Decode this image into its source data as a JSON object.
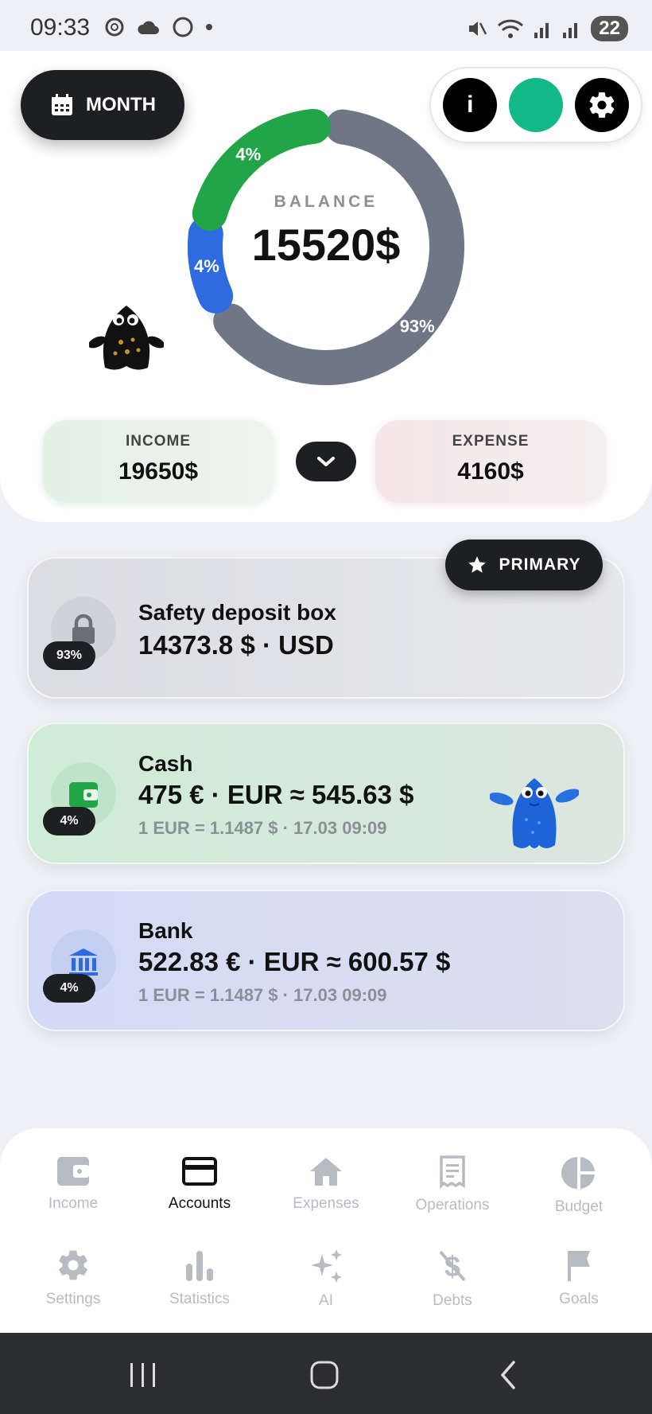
{
  "status_bar": {
    "time": "09:33",
    "battery": "22"
  },
  "header": {
    "period_button": "MONTH",
    "info_button": "i",
    "theme_color": "#12b886",
    "settings_icon": "gear-icon"
  },
  "balance": {
    "label": "BALANCE",
    "value": "15520$",
    "segments": [
      {
        "percent_label": "93%",
        "color": "#6f7685",
        "fraction": 0.93
      },
      {
        "percent_label": "4%",
        "color": "#2f6be0",
        "fraction": 0.04
      },
      {
        "percent_label": "4%",
        "color": "#22a546",
        "fraction": 0.04
      }
    ]
  },
  "summary": {
    "income_label": "INCOME",
    "income_value": "19650$",
    "expense_label": "EXPENSE",
    "expense_value": "4160$"
  },
  "primary_badge": "PRIMARY",
  "accounts": [
    {
      "name": "Safety deposit box",
      "amount": "14373.8 $ · USD",
      "rate": "",
      "percent": "93%",
      "icon": "lock-icon",
      "tint": "#e3e4e8"
    },
    {
      "name": "Cash",
      "amount": "475 € · EUR  ≈  545.63 $",
      "rate": "1 EUR = 1.1487 $ · 17.03 09:09",
      "percent": "4%",
      "icon": "wallet-icon",
      "tint": "#d7eedd"
    },
    {
      "name": "Bank",
      "amount": "522.83 € · EUR  ≈  600.57 $",
      "rate": "1 EUR = 1.1487 $ · 17.03 09:09",
      "percent": "4%",
      "icon": "bank-icon",
      "tint": "#d9def3"
    }
  ],
  "nav": {
    "row1": [
      "Income",
      "Accounts",
      "Expenses",
      "Operations",
      "Budget"
    ],
    "row2": [
      "Settings",
      "Statistics",
      "AI",
      "Debts",
      "Goals"
    ],
    "active": "Accounts"
  }
}
